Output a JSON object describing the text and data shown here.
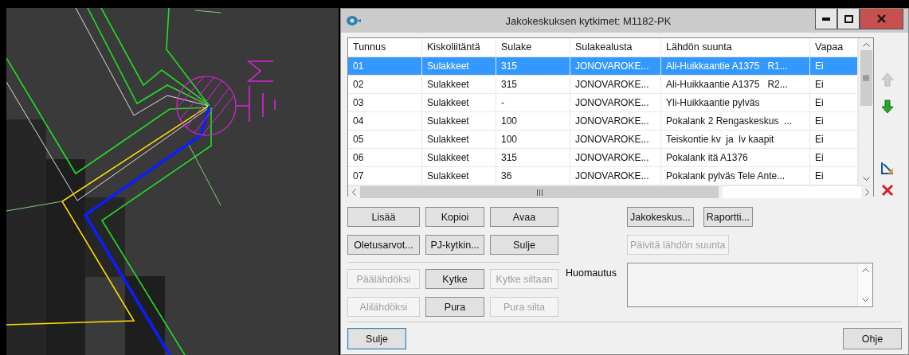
{
  "window": {
    "title": "Jakokeskuksen kytkimet: M1182-PK"
  },
  "table": {
    "columns": [
      "Tunnus",
      "Kiskoliitäntä",
      "Sulake",
      "Sulakealusta",
      "Lähdön suunta",
      "Vapaa"
    ],
    "rows": [
      {
        "cells": [
          "01",
          "Sulakkeet",
          "315",
          "JONOVAROKE...",
          "Ali-Huikkaantie A1375   R1...",
          "Ei"
        ],
        "selected": true
      },
      {
        "cells": [
          "02",
          "Sulakkeet",
          "315",
          "JONOVAROKE...",
          "Ali-Huikkaantie A1375   R2...",
          "Ei"
        ],
        "selected": false
      },
      {
        "cells": [
          "03",
          "Sulakkeet",
          "-",
          "JONOVAROKE...",
          "Yli-Huikkaantie pylväs",
          "Ei"
        ],
        "selected": false
      },
      {
        "cells": [
          "04",
          "Sulakkeet",
          "100",
          "JONOVAROKE...",
          "Pokalank 2 Rengaskeskus  ...",
          "Ei"
        ],
        "selected": false
      },
      {
        "cells": [
          "05",
          "Sulakkeet",
          "100",
          "JONOVAROKE...",
          "Teiskontie kv  ja  lv kaapit",
          "Ei"
        ],
        "selected": false
      },
      {
        "cells": [
          "06",
          "Sulakkeet",
          "315",
          "JONOVAROKE...",
          "Pokalank itä A1376",
          "Ei"
        ],
        "selected": false
      },
      {
        "cells": [
          "07",
          "Sulakkeet",
          "36",
          "JONOVAROKE...",
          "Pokalank pylväs Tele Ante...",
          "Ei"
        ],
        "selected": false
      }
    ]
  },
  "side_tools": [
    {
      "kind": "up",
      "disabled": true
    },
    {
      "kind": "down",
      "disabled": false
    },
    {
      "kind": "edit",
      "disabled": false
    },
    {
      "kind": "delete",
      "disabled": false
    }
  ],
  "left_buttons": [
    {
      "label": "Lisää",
      "disabled": false
    },
    {
      "label": "Kopioi",
      "disabled": false
    },
    {
      "label": "Avaa",
      "disabled": false
    },
    {
      "label": "Oletusarvot...",
      "disabled": false
    },
    {
      "label": "PJ-kytkin...",
      "disabled": false
    },
    {
      "label": "Sulje",
      "disabled": false
    }
  ],
  "switch_buttons": [
    {
      "label": "Päälähdöksi",
      "disabled": true
    },
    {
      "label": "Kytke",
      "disabled": false
    },
    {
      "label": "Kytke siltaan",
      "disabled": true
    },
    {
      "label": "Alilähdöksi",
      "disabled": true
    },
    {
      "label": "Pura",
      "disabled": false
    },
    {
      "label": "Pura silta",
      "disabled": true
    }
  ],
  "right_buttons": [
    {
      "label": "Jakokeskus...",
      "disabled": false
    },
    {
      "label": "Raportti...",
      "disabled": false
    }
  ],
  "update_button": {
    "label": "Päivitä lähdön suunta",
    "disabled": true
  },
  "note": {
    "label": "Huomautus"
  },
  "footer_buttons": [
    {
      "label": "Sulje",
      "focused": true
    },
    {
      "label": "Ohje",
      "focused": false
    }
  ]
}
